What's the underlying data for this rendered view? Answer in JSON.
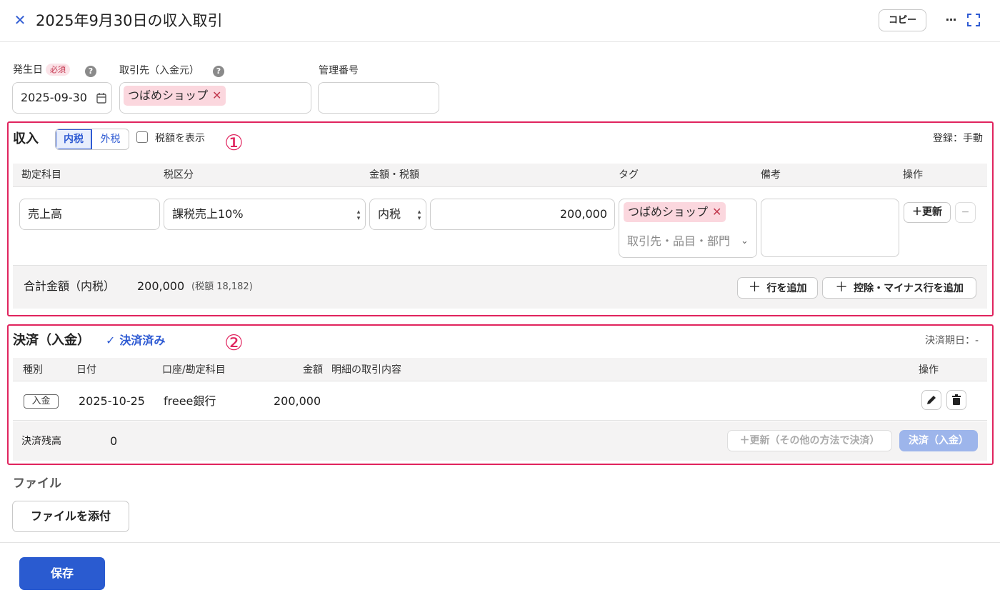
{
  "header": {
    "title": "2025年9月30日の収入取引",
    "copy_label": "コピー",
    "more_label": "···"
  },
  "form": {
    "date_label": "発生日",
    "required_label": "必須",
    "date_value": "2025-09-30",
    "partner_label": "取引先（入金元）",
    "partner_tag": "つばめショップ",
    "manage_no_label": "管理番号",
    "manage_no_value": ""
  },
  "income": {
    "title": "収入",
    "tax_modes": [
      "内税",
      "外税"
    ],
    "show_tax_label": "税額を表示",
    "marker": "①",
    "registration": "登録：手動",
    "columns": [
      "勘定科目",
      "税区分",
      "金額・税額",
      "タグ",
      "備考",
      "操作"
    ],
    "row": {
      "account": "売上高",
      "tax_category": "課税売上10%",
      "tax_mode": "内税",
      "amount": "200,000",
      "tag": "つばめショップ",
      "tag_placeholder": "取引先・品目・部門",
      "note": "",
      "update_label": "＋更新",
      "remove_label": "−"
    },
    "total_label": "合計金額（内税）",
    "total_value": "200,000",
    "total_tax": "(税額 18,182)",
    "add_row_label": "行を追加",
    "add_minus_row_label": "控除・マイナス行を追加"
  },
  "settlement": {
    "title": "決済（入金）",
    "status": "決済済み",
    "marker": "②",
    "due_date": "決済期日：-",
    "columns": [
      "種別",
      "日付",
      "口座/勘定科目",
      "金額",
      "明細の取引内容",
      "操作"
    ],
    "row": {
      "type": "入金",
      "date": "2025-10-25",
      "account": "freee銀行",
      "amount": "200,000",
      "detail": ""
    },
    "balance_label": "決済残高",
    "balance_value": "0",
    "update_other_label": "＋更新（その他の方法で決済）",
    "settle_label": "決済（入金）"
  },
  "file": {
    "title": "ファイル",
    "attach_label": "ファイルを添付"
  },
  "footer": {
    "save_label": "保存"
  }
}
